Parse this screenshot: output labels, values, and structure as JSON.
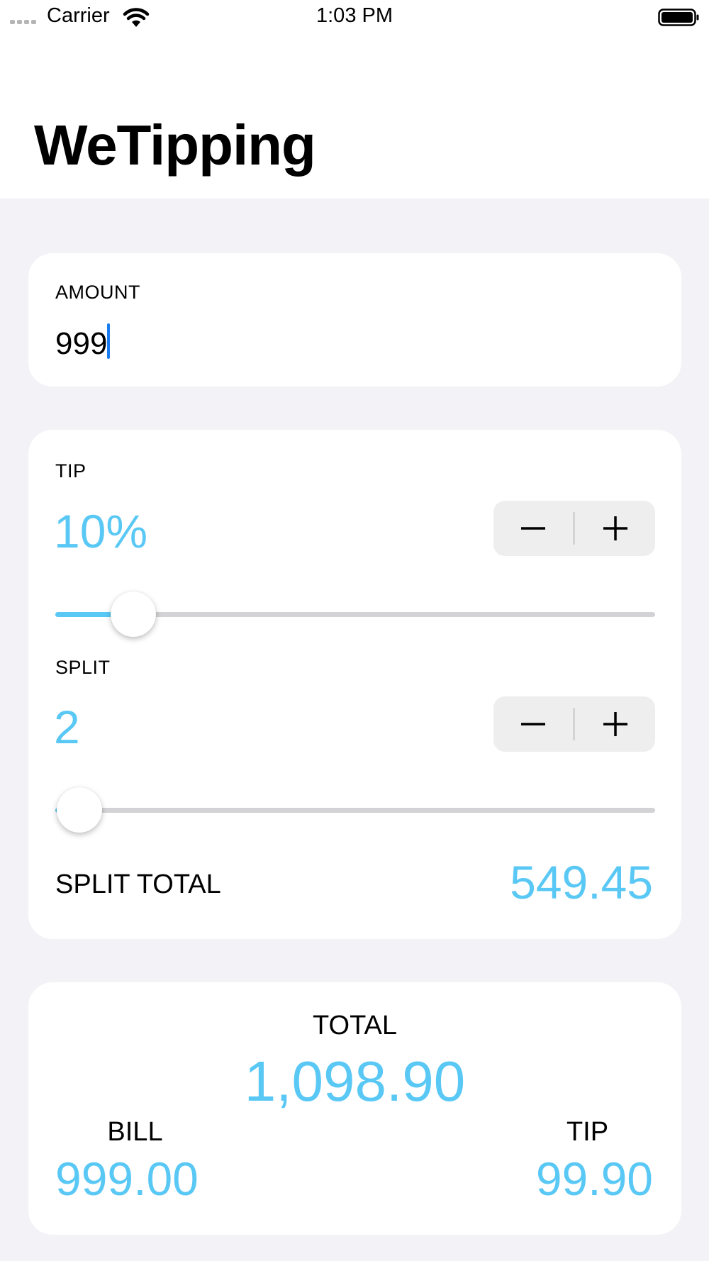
{
  "status_bar": {
    "carrier": "Carrier",
    "time": "1:03 PM",
    "icons": [
      "signal-dots-icon",
      "wifi-icon",
      "battery-icon"
    ]
  },
  "app": {
    "title": "WeTipping"
  },
  "amount": {
    "label": "AMOUNT",
    "value": "999"
  },
  "tip": {
    "label": "TIP",
    "value": "10%",
    "slider_fraction": 0.13,
    "stepper": {
      "minus_icon": "minus-icon",
      "plus_icon": "plus-icon"
    }
  },
  "split": {
    "label": "SPLIT",
    "value": "2",
    "slider_fraction": 0.04,
    "stepper": {
      "minus_icon": "minus-icon",
      "plus_icon": "plus-icon"
    }
  },
  "split_total": {
    "label": "SPLIT TOTAL",
    "value": "549.45"
  },
  "summary": {
    "total_label": "TOTAL",
    "total_value": "1,098.90",
    "bill_label": "BILL",
    "bill_value": "999.00",
    "tip_label": "TIP",
    "tip_value": "99.90"
  },
  "colors": {
    "accent": "#5ac8f5",
    "background": "#f2f2f7",
    "card": "#ffffff",
    "caret": "#1a7cf0"
  }
}
